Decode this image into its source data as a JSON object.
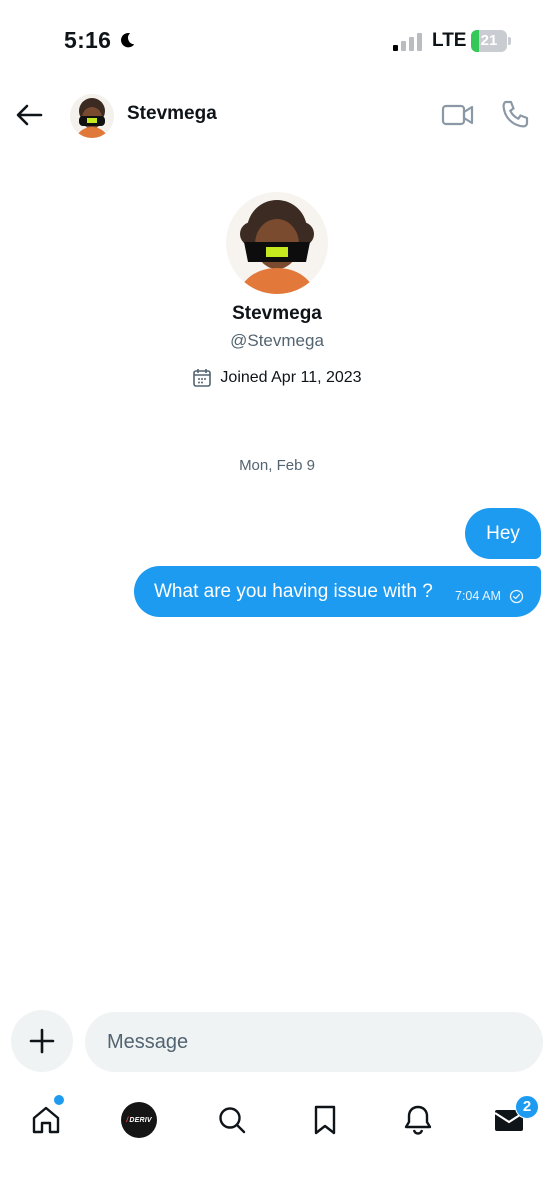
{
  "status_bar": {
    "time": "5:16",
    "network": "LTE",
    "battery": "21",
    "battery_level": 0.21,
    "icons": [
      "moon-icon",
      "signal-icon",
      "battery-icon"
    ]
  },
  "header": {
    "name": "Stevmega",
    "icons": [
      "back-arrow-icon",
      "avatar",
      "video-call-icon",
      "phone-icon"
    ]
  },
  "profile": {
    "name": "Stevmega",
    "handle": "@Stevmega",
    "joined": "Joined Apr 11, 2023"
  },
  "conversation": {
    "date": "Mon, Feb 9",
    "messages": [
      {
        "text": "Hey",
        "time": ""
      },
      {
        "text": "What are you having issue with ?",
        "time": "7:04 AM"
      }
    ]
  },
  "composer": {
    "placeholder": "Message"
  },
  "tab_bar": {
    "tabs": [
      "home-icon",
      "deriv-logo",
      "search-icon",
      "bookmark-icon",
      "bell-icon",
      "mail-icon"
    ],
    "deriv_text": "DERIV",
    "messages_badge": "2"
  },
  "colors": {
    "accent": "#1d9bf0",
    "text": "#0f1419",
    "muted": "#536471",
    "input_bg": "#eff3f4",
    "battery_green": "#34c759"
  }
}
